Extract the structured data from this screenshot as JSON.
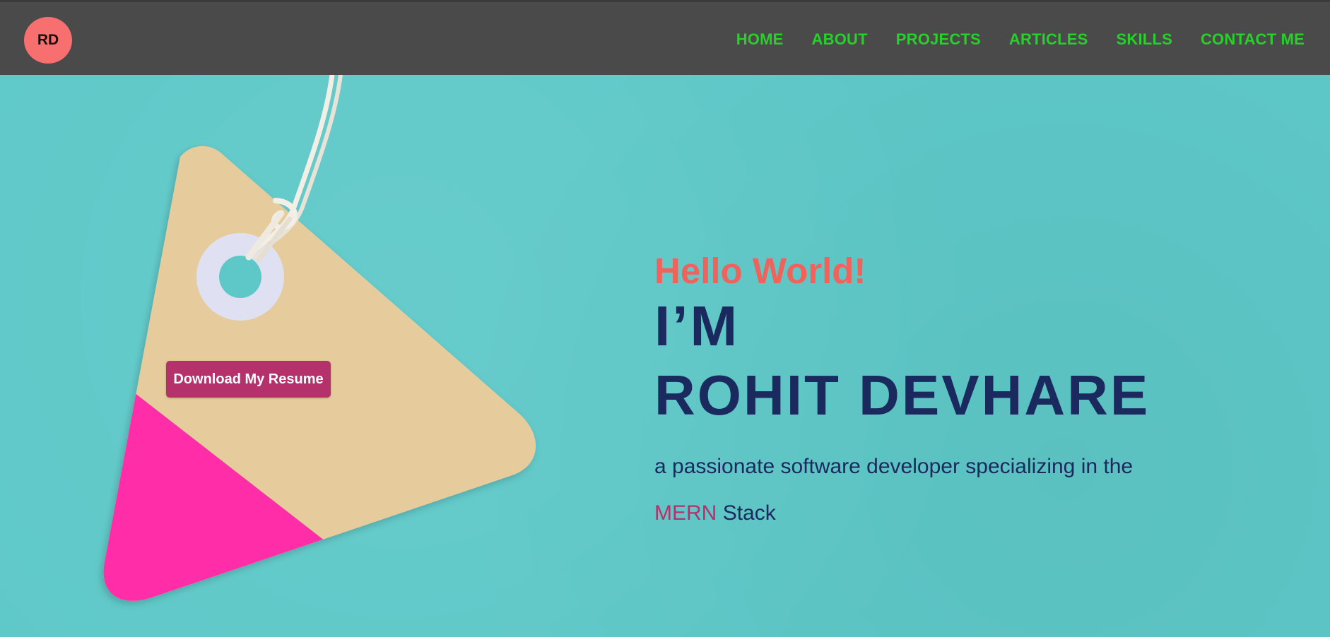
{
  "logo": {
    "initials": "RD"
  },
  "nav": {
    "items": [
      {
        "label": "HOME"
      },
      {
        "label": "ABOUT"
      },
      {
        "label": "PROJECTS"
      },
      {
        "label": "ARTICLES"
      },
      {
        "label": "SKILLS"
      },
      {
        "label": "CONTACT ME"
      }
    ]
  },
  "hero": {
    "greeting": "Hello World!",
    "intro": "I’M",
    "name": "ROHIT DEVHARE",
    "tagline_start": "a passionate software developer specializing in the",
    "tagline_highlight": "MERN",
    "tagline_end": "Stack"
  },
  "download_button": {
    "label": "Download My Resume"
  },
  "colors": {
    "navbar_bg": "#4a4a4a",
    "nav_link": "#28d02c",
    "logo_bg": "#f86f6f",
    "page_bg": "#5ec8c8",
    "greeting": "#f0625a",
    "heading": "#1b2a5e",
    "accent": "#b5316b",
    "tag_paper": "#e6cc9c",
    "tag_pink": "#ff2ea8"
  }
}
